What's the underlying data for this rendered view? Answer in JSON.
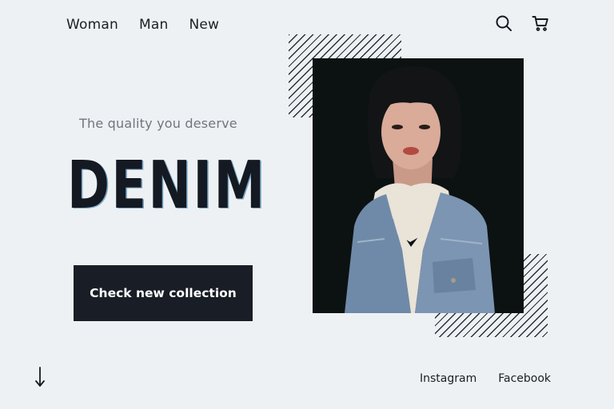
{
  "nav": {
    "items": [
      {
        "label": "Woman"
      },
      {
        "label": "Man"
      },
      {
        "label": "New"
      }
    ]
  },
  "header_icons": [
    "search-icon",
    "cart-icon"
  ],
  "hero": {
    "tagline": "The quality you deserve",
    "headline": "DENIM",
    "cta_label": "Check new collection"
  },
  "footer": {
    "scroll_icon": "arrow-down-icon",
    "social": [
      {
        "label": "Instagram"
      },
      {
        "label": "Facebook"
      }
    ]
  },
  "colors": {
    "background": "#eef1f3",
    "ink": "#15181d",
    "muted": "#71767d",
    "button": "#191d25",
    "photo_bg": "#0c1212"
  }
}
